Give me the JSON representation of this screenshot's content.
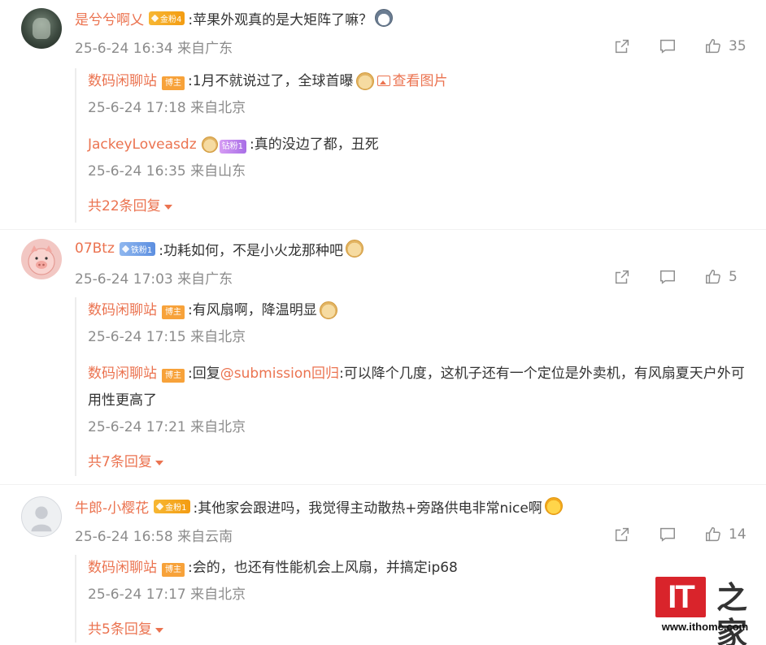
{
  "comments": [
    {
      "user": "是兮兮啊乂",
      "badge": "金粉4",
      "text": ":苹果外观真的是大矩阵了嘛？",
      "meta": "25-6-24 16:34 来自广东",
      "likes": "35",
      "replies": [
        {
          "user": "数码闲聊站",
          "badge": "博主",
          "text": ":1月不就说过了，全球首曝",
          "link": "查看图片",
          "meta": "25-6-24 17:18 来自北京"
        },
        {
          "user": "JackeyLoveasdz",
          "badge": "钻粉1",
          "text": ":真的没边了都，丑死",
          "meta": "25-6-24 16:35 来自山东"
        }
      ],
      "more": "共22条回复"
    },
    {
      "user": "07Btz",
      "badge": "铁粉1",
      "text": ":功耗如何，不是小火龙那种吧",
      "meta": "25-6-24 17:03 来自广东",
      "likes": "5",
      "replies": [
        {
          "user": "数码闲聊站",
          "badge": "博主",
          "text": ":有风扇啊，降温明显",
          "meta": "25-6-24 17:15 来自北京"
        },
        {
          "user": "数码闲聊站",
          "badge": "博主",
          "prefix": ":回复",
          "mention": "@submission回归",
          "text": ":可以降个几度，这机子还有一个定位是外卖机，有风扇夏天户外可用性更高了",
          "meta": "25-6-24 17:21 来自北京"
        }
      ],
      "more": "共7条回复"
    },
    {
      "user": "牛郎-小樱花",
      "badge": "金粉1",
      "text": ":其他家会跟进吗，我觉得主动散热+旁路供电非常nice啊",
      "meta": "25-6-24 16:58 来自云南",
      "likes": "14",
      "replies": [
        {
          "user": "数码闲聊站",
          "badge": "博主",
          "text": ":会的，也还有性能机会上风扇，并搞定ip68",
          "meta": "25-6-24 17:17 来自北京"
        }
      ],
      "more": "共5条回复"
    }
  ],
  "watermark": {
    "logo": "IT",
    "logo_cn": "之家",
    "url": "www.ithome.com"
  },
  "colors": {
    "accent": "#eb7350",
    "meta": "#8c8c8c",
    "gold_badge": "#f39c12",
    "iron_badge": "#5d8fe0",
    "diamond_badge": "#a86ee6",
    "author_badge": "#f7a23a",
    "logo_red": "#d9242b"
  },
  "icons": [
    "share-icon",
    "comment-icon",
    "like-icon",
    "picture-icon",
    "caret-down-icon"
  ]
}
